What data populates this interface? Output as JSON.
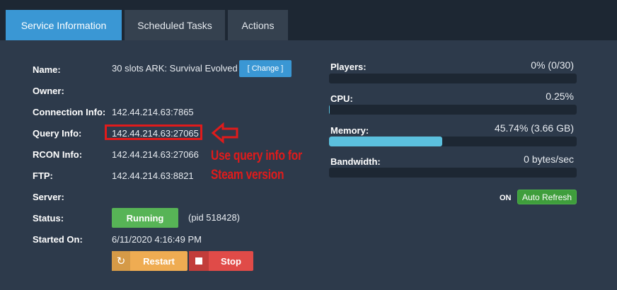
{
  "tabs": [
    {
      "label": "Service Information",
      "active": true
    },
    {
      "label": "Scheduled Tasks",
      "active": false
    },
    {
      "label": "Actions",
      "active": false
    }
  ],
  "info": {
    "name_label": "Name:",
    "name_value": "30 slots ARK: Survival Evolved",
    "change_button": "[ Change ]",
    "owner_label": "Owner:",
    "owner_value": "",
    "connection_label": "Connection Info:",
    "connection_value": "142.44.214.63:7865",
    "query_label": "Query Info:",
    "query_value": "142.44.214.63:27065",
    "rcon_label": "RCON Info:",
    "rcon_value": "142.44.214.63:27066",
    "ftp_label": "FTP:",
    "ftp_value": "142.44.214.63:8821",
    "server_label": "Server:",
    "server_value": "",
    "status_label": "Status:",
    "status_value": "Running",
    "pid_text": "(pid 518428)",
    "started_label": "Started On:",
    "started_value": "6/11/2020 4:16:49 PM"
  },
  "annotation": {
    "line1": "Use query info for",
    "line2": "Steam version",
    "color": "#e01b1b"
  },
  "controls": {
    "restart_label": "Restart",
    "stop_label": "Stop"
  },
  "metrics": [
    {
      "label": "Players:",
      "value": "0% (0/30)",
      "fraction": 0.0
    },
    {
      "label": "CPU:",
      "value": "0.25%",
      "fraction": 0.0025
    },
    {
      "label": "Memory:",
      "value": "45.74% (3.66 GB)",
      "fraction": 0.4574
    },
    {
      "label": "Bandwidth:",
      "value": "0 bytes/sec",
      "fraction": 0.0
    }
  ],
  "auto_refresh": {
    "state": "ON",
    "label": "Auto Refresh"
  },
  "colors": {
    "accent": "#3a97d4",
    "running": "#57b456",
    "restart": "#efac52",
    "stop": "#e04b48",
    "memory_bar": "#5bc0de",
    "auto_refresh": "#3f9e3c"
  }
}
